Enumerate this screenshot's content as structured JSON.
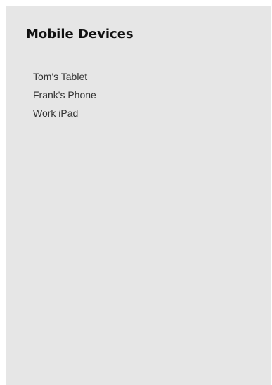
{
  "panel": {
    "title": "Mobile Devices",
    "devices": [
      {
        "label": "Tom's Tablet"
      },
      {
        "label": "Frank's Phone"
      },
      {
        "label": "Work iPad"
      }
    ]
  },
  "colors": {
    "panel_background": "#e6e6e6",
    "text": "#333333",
    "title": "#111111"
  }
}
